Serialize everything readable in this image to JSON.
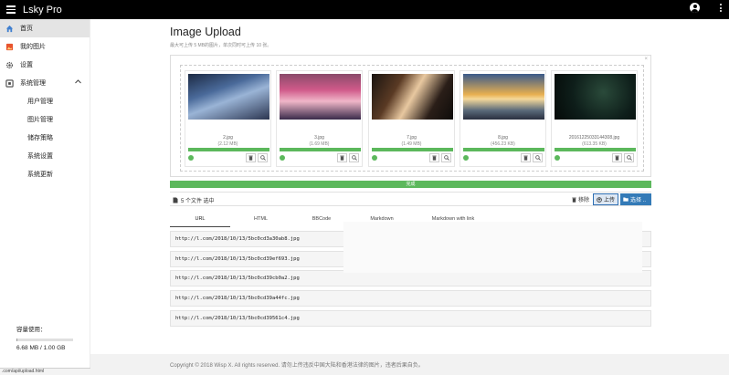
{
  "app": {
    "title": "Lsky Pro"
  },
  "sidebar": {
    "items": [
      {
        "label": "首页",
        "icon": "home-icon",
        "active": true
      },
      {
        "label": "我的图片",
        "icon": "image-icon",
        "active": false
      },
      {
        "label": "设置",
        "icon": "gear-icon",
        "active": false
      },
      {
        "label": "系统管理",
        "icon": "admin-icon",
        "active": false,
        "expanded": true
      }
    ],
    "subitems": [
      {
        "label": "用户管理"
      },
      {
        "label": "图片管理"
      },
      {
        "label": "储存策略"
      },
      {
        "label": "系统设置"
      },
      {
        "label": "系统更新"
      }
    ],
    "storage": {
      "label": "容量使用：",
      "value": "6.68 MB / 1.00 GB",
      "used_fraction": 0.0065
    }
  },
  "status_url": ".com/api/upload.html",
  "main": {
    "title": "Image Upload",
    "subtitle": "最大可上传 5 MB的图片，单次同时可上传 10 张。",
    "files": [
      {
        "name": "2.jpg",
        "size": "(2.12 MB)",
        "progress": 1
      },
      {
        "name": "3.jpg",
        "size": "(1.69 MB)",
        "progress": 1
      },
      {
        "name": "7.jpg",
        "size": "(1.49 MB)",
        "progress": 1
      },
      {
        "name": "8.jpg",
        "size": "(456.23 KB)",
        "progress": 1
      },
      {
        "name": "20161225033144308.jpg",
        "size": "(613.35 KB)",
        "progress": 1
      }
    ],
    "overall_progress": {
      "label": "完成",
      "value": 1
    },
    "file_caption": "5 个文件 选中",
    "actions": {
      "remove": "移除",
      "upload": "上传",
      "browse": "选择 .."
    },
    "tabs": [
      "URL",
      "HTML",
      "BBCode",
      "Markdown",
      "Markdown with link"
    ],
    "links": [
      "http://l.com/2018/10/13/5bc0cd3a30ab8.jpg",
      "http://l.com/2018/10/13/5bc0cd39ef693.jpg",
      "http://l.com/2018/10/13/5bc0cd39cb0a2.jpg",
      "http://l.com/2018/10/13/5bc0cd39a44fc.jpg",
      "http://l.com/2018/10/13/5bc0cd39561c4.jpg"
    ]
  },
  "footer": {
    "text": "Copyright © 2018 Wisp X. All rights reserved. 请勿上传违反中国大陆和香港法律的图片，违者后果自负。"
  },
  "colors": {
    "topbar": "#000000",
    "success": "#5cb85c",
    "primary": "#337ab7"
  }
}
